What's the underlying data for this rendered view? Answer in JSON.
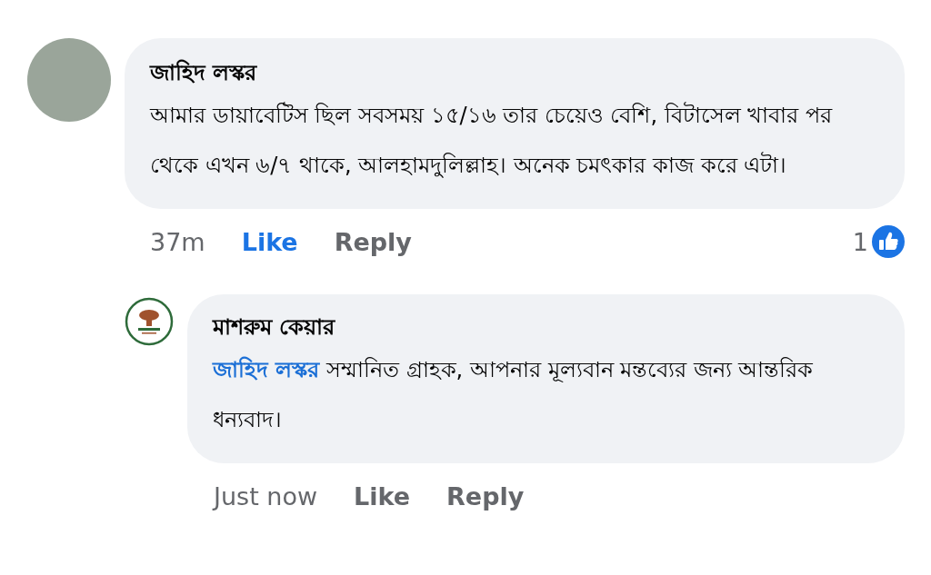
{
  "comments": [
    {
      "kind": "comment",
      "author": "জাহিদ লস্কর",
      "text": "আমার ডায়াবেটিস ছিল সবসময় ১৫/১৬ তার চেয়েও বেশি, বিটাসেল খাবার পর থেকে এখন ৬/৭ থাকে, আলহামদুলিল্লাহ। অনেক চমৎকার কাজ করে এটা।",
      "time": "37m",
      "like_label": "Like",
      "liked": true,
      "reply_label": "Reply",
      "reaction_count": "1"
    },
    {
      "kind": "reply",
      "author": "মাশরুম কেয়ার",
      "mention": "জাহিদ লস্কর",
      "text": "সম্মানিত গ্রাহক, আপনার মূল্যবান মন্তব্যের জন্য আন্তরিক ধন্যবাদ।",
      "time": "Just now",
      "like_label": "Like",
      "liked": false,
      "reply_label": "Reply"
    }
  ]
}
